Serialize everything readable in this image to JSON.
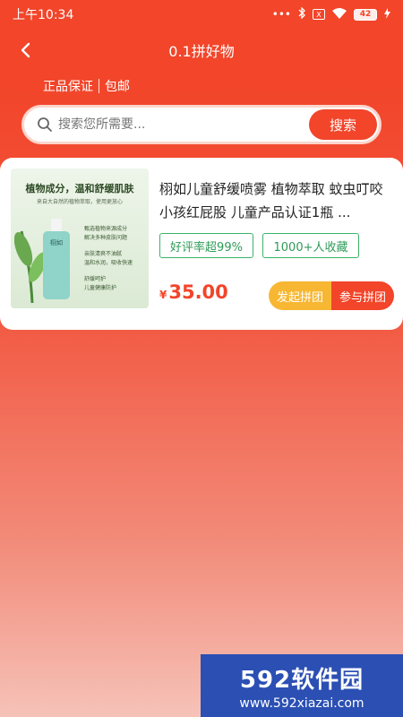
{
  "status": {
    "time": "上午10:34",
    "sim": "X",
    "battery": "42"
  },
  "nav": {
    "title": "0.1拼好物"
  },
  "guarantee": {
    "item1": "正品保证",
    "item2": "包邮"
  },
  "search": {
    "placeholder": "搜索您所需要...",
    "button": "搜索"
  },
  "product": {
    "image": {
      "headline": "植物成分，温和舒缓肌肤",
      "subline": "来自大自然的植物萃取，使用更放心",
      "bottle": "栩如",
      "features": [
        "甄选植物来源成分",
        "解决多种皮肤问题",
        "亲肤清爽不油腻",
        "温和水润，吸收快速",
        "舒缓呵护",
        "儿童健康防护"
      ]
    },
    "title": "栩如儿童舒缓喷雾 植物萃取 蚊虫叮咬 小孩红屁股 儿童产品认证1瓶 ...",
    "tags": [
      "好评率超99%",
      "1000+人收藏"
    ],
    "currency": "¥",
    "price": "35.00",
    "btn_start": "发起拼团",
    "btn_join": "参与拼团"
  },
  "watermark": {
    "brand": "592软件园",
    "url": "www.592xiazai.com"
  },
  "colors": {
    "primary": "#f2452a",
    "tag_green": "#3bb36a",
    "start_btn": "#f7b733",
    "watermark_bg": "#2b4fb3"
  }
}
